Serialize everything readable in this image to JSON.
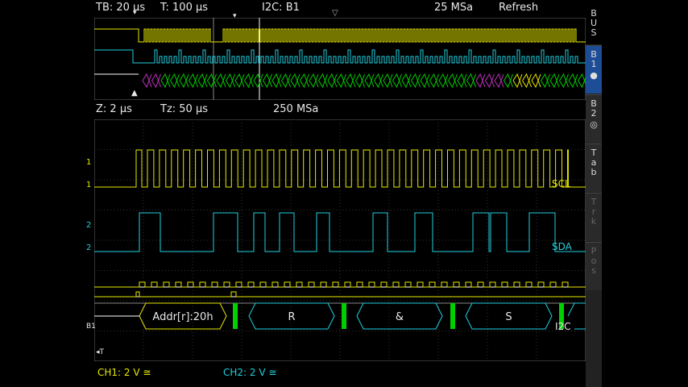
{
  "overview": {
    "timebase": "TB: 20 µs",
    "trigger_time": "T: 100 µs",
    "bus_label": "I2C: B1",
    "sample_rate": "25 MSa",
    "mode": "Refresh"
  },
  "zoom": {
    "zoom_scale": "Z: 2 µs",
    "zoom_time": "Tz: 50 µs",
    "sample_rate": "250 MSa"
  },
  "channels": {
    "ch1_label": "SCL",
    "ch2_label": "SDA",
    "ch1_status": "CH1: 2 V ≅",
    "ch2_status": "CH2: 2 V ≅",
    "ch1_marker": "1",
    "ch2_marker": "2",
    "bus_marker": "B1",
    "trigger_marker": "T",
    "bus_name": "I2C"
  },
  "decode": {
    "frames": [
      "Addr[r]:20h",
      "R",
      "&",
      "S"
    ]
  },
  "sidebar": {
    "bus": "BUS",
    "b1": "B1",
    "b2": "B2",
    "tab": "Tab",
    "trk": "Trk",
    "pos": "Pos"
  },
  "colors": {
    "ch1": "#e8e800",
    "ch2": "#20d0e0",
    "ack": "#00d000",
    "active_button": "#1c4d96"
  }
}
